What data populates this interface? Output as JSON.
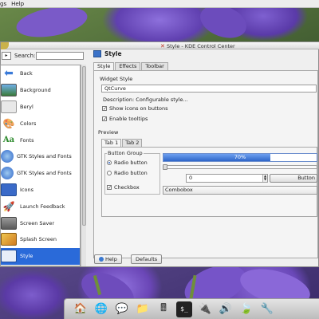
{
  "menubar": {
    "items": [
      "gs",
      "Help"
    ]
  },
  "window": {
    "title": "Style - KDE Control Center"
  },
  "sidebar": {
    "search_label": "Search:",
    "search_value": "",
    "items": [
      {
        "label": "Back",
        "icon": "arrow-left-icon",
        "color": "#3a7ad8"
      },
      {
        "label": "Background",
        "icon": "monitor-icon",
        "color": "#4e9ed6"
      },
      {
        "label": "Beryl",
        "icon": "beryl-icon",
        "color": "#cfcfcf"
      },
      {
        "label": "Colors",
        "icon": "palette-icon",
        "color": "#e6a030"
      },
      {
        "label": "Fonts",
        "icon": "font-icon",
        "color": "#2d8a2d"
      },
      {
        "label": "GTK Styles and Fonts",
        "icon": "gtk-icon",
        "color": "#3a7ad8"
      },
      {
        "label": "GTK Styles and Fonts",
        "icon": "gtk-icon",
        "color": "#3a7ad8"
      },
      {
        "label": "Icons",
        "icon": "icons-icon",
        "color": "#3a6ac8"
      },
      {
        "label": "Launch Feedback",
        "icon": "launch-feedback-icon",
        "color": "#e05a2a"
      },
      {
        "label": "Screen Saver",
        "icon": "screen-saver-icon",
        "color": "#7a7a7a"
      },
      {
        "label": "Splash Screen",
        "icon": "splash-icon",
        "color": "#e6b030"
      },
      {
        "label": "Style",
        "icon": "style-icon",
        "color": "#3a6ac8",
        "selected": true
      }
    ]
  },
  "main": {
    "heading": "Style",
    "tabs": [
      "Style",
      "Effects",
      "Toolbar"
    ],
    "widget_style_title": "Widget Style",
    "widget_style_value": "QtCurve",
    "description": "Description: Configurable style...",
    "options": [
      {
        "label": "Show icons on buttons",
        "checked": true
      },
      {
        "label": "Enable tooltips",
        "checked": true
      }
    ],
    "preview": {
      "title": "Preview",
      "tabs": [
        "Tab 1",
        "Tab 2"
      ],
      "button_group_title": "Button Group",
      "radios": [
        {
          "label": "Radio button",
          "checked": true
        },
        {
          "label": "Radio button",
          "checked": false
        }
      ],
      "checkbox": {
        "label": "Checkbox",
        "checked": true
      },
      "progress": {
        "value": 70,
        "label": "70%"
      },
      "slider_value": 0,
      "spinbox_value": "0",
      "button_label": "Button",
      "combobox_label": "Combobox"
    },
    "footer": {
      "help": "Help",
      "defaults": "Defaults"
    }
  },
  "taskbar": {
    "icons": [
      {
        "name": "home-icon",
        "glyph": "🏠"
      },
      {
        "name": "network-icon",
        "glyph": "🌐"
      },
      {
        "name": "chat-icon",
        "glyph": "💬"
      },
      {
        "name": "folder-icon",
        "glyph": "📁"
      },
      {
        "name": "calculator-icon",
        "glyph": "🖩"
      },
      {
        "name": "terminal-icon",
        "glyph": "$_"
      },
      {
        "name": "plug-icon",
        "glyph": "🔌"
      },
      {
        "name": "speaker-icon",
        "glyph": "🔊"
      },
      {
        "name": "leaf-icon",
        "glyph": "🍃"
      },
      {
        "name": "tools-icon",
        "glyph": "🔧"
      }
    ]
  }
}
